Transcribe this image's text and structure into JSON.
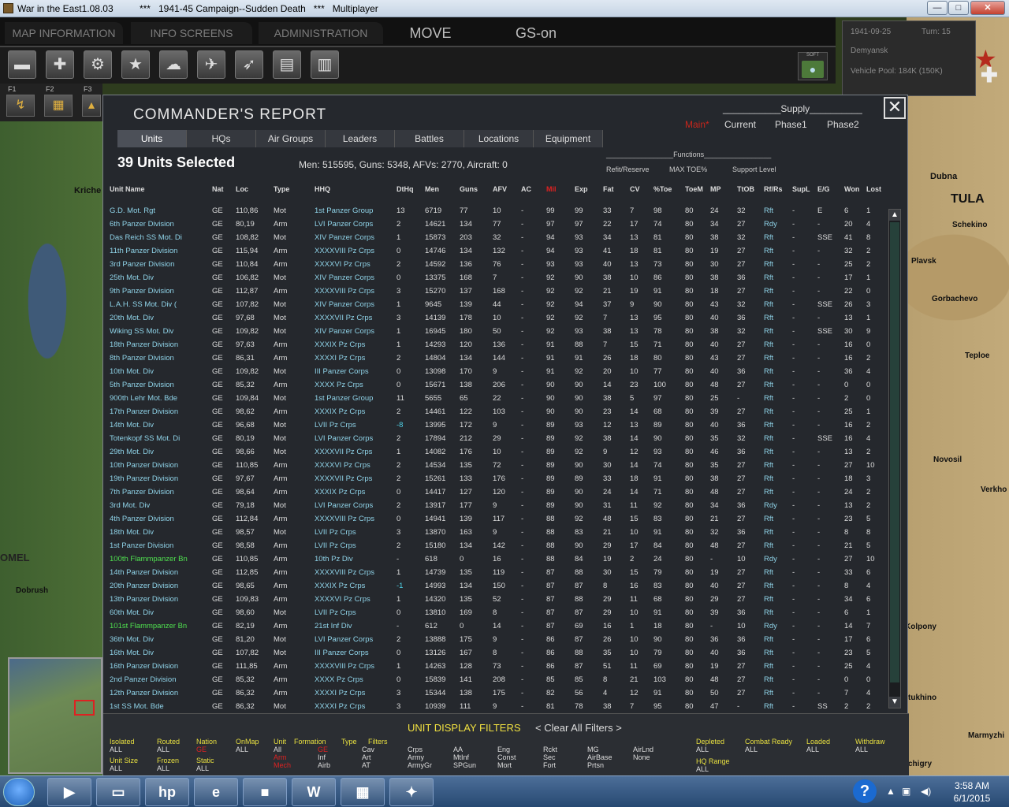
{
  "window": {
    "title": "War in the East1.08.03          ***   1941-45 Campaign--Sudden Death   ***   Multiplayer",
    "min": "—",
    "max": "□",
    "close": "✕"
  },
  "menu": {
    "map_info": "MAP INFORMATION",
    "info_screens": "INFO SCREENS",
    "administration": "ADMINISTRATION",
    "move": "MOVE",
    "gs": "GS-on"
  },
  "info": {
    "date": "1941-09-25",
    "turn": "Turn: 15",
    "location": "Demyansk",
    "vehicle_pool": "Vehicle Pool: 184K (150K)"
  },
  "soft": {
    "label": "SOFT"
  },
  "fkeys": [
    "F1",
    "F2",
    "F3"
  ],
  "report": {
    "title": "COMMANDER'S REPORT",
    "close": "✕",
    "supply": {
      "heading": "___________Supply__________",
      "main": "Main*",
      "current": "Current",
      "phase1": "Phase1",
      "phase2": "Phase2"
    },
    "tabs": [
      "Units",
      "HQs",
      "Air Groups",
      "Leaders",
      "Battles",
      "Locations",
      "Equipment"
    ],
    "selected": "39 Units Selected",
    "stats": "Men: 515595, Guns: 5348, AFVs: 2770, Aircraft: 0",
    "functions": {
      "heading": "_________________Functions_________________",
      "refit": "Refit/Reserve",
      "maxtoe": "MAX TOE%",
      "support": "Support Level"
    },
    "columns": [
      "Unit Name",
      "Nat",
      "Loc",
      "Type",
      "HHQ",
      "DtHq",
      "Men",
      "Guns",
      "AFV",
      "AC",
      "Mil",
      "Exp",
      "Fat",
      "CV",
      "%Toe",
      "ToeM",
      "MP",
      "TtOB",
      "Rf/Rs",
      "SupL",
      "E/G",
      "Won",
      "Lost"
    ],
    "rows": [
      [
        "G.D. Mot. Rgt",
        "GE",
        "110,86",
        "Mot",
        "1st Panzer Group",
        "13",
        "6719",
        "77",
        "10",
        "-",
        "99",
        "99",
        "33",
        "7",
        "98",
        "80",
        "24",
        "32",
        "Rft",
        "-",
        "E",
        "6",
        "1"
      ],
      [
        "6th Panzer Division",
        "GE",
        "80,19",
        "Arm",
        "LVI Panzer Corps",
        "2",
        "14621",
        "134",
        "77",
        "-",
        "97",
        "97",
        "22",
        "17",
        "74",
        "80",
        "34",
        "27",
        "Rdy",
        "-",
        "-",
        "20",
        "4"
      ],
      [
        "Das Reich SS Mot. Di",
        "GE",
        "108,82",
        "Mot",
        "XIV Panzer Corps",
        "1",
        "15873",
        "203",
        "32",
        "-",
        "94",
        "93",
        "34",
        "13",
        "81",
        "80",
        "38",
        "32",
        "Rft",
        "-",
        "SSE",
        "41",
        "8"
      ],
      [
        "11th Panzer Division",
        "GE",
        "115,94",
        "Arm",
        "XXXXVIII Pz Crps",
        "0",
        "14746",
        "134",
        "132",
        "-",
        "94",
        "93",
        "41",
        "18",
        "81",
        "80",
        "19",
        "27",
        "Rft",
        "-",
        "-",
        "32",
        "2"
      ],
      [
        "3rd Panzer Division",
        "GE",
        "110,84",
        "Arm",
        "XXXXVI Pz Crps",
        "2",
        "14592",
        "136",
        "76",
        "-",
        "93",
        "93",
        "40",
        "13",
        "73",
        "80",
        "30",
        "27",
        "Rft",
        "-",
        "-",
        "25",
        "2"
      ],
      [
        "25th Mot. Div",
        "GE",
        "106,82",
        "Mot",
        "XIV Panzer Corps",
        "0",
        "13375",
        "168",
        "7",
        "-",
        "92",
        "90",
        "38",
        "10",
        "86",
        "80",
        "38",
        "36",
        "Rft",
        "-",
        "-",
        "17",
        "1"
      ],
      [
        "9th Panzer Division",
        "GE",
        "112,87",
        "Arm",
        "XXXXVIII Pz Crps",
        "3",
        "15270",
        "137",
        "168",
        "-",
        "92",
        "92",
        "21",
        "19",
        "91",
        "80",
        "18",
        "27",
        "Rft",
        "-",
        "-",
        "22",
        "0"
      ],
      [
        "L.A.H. SS Mot. Div (",
        "GE",
        "107,82",
        "Mot",
        "XIV Panzer Corps",
        "1",
        "9645",
        "139",
        "44",
        "-",
        "92",
        "94",
        "37",
        "9",
        "90",
        "80",
        "43",
        "32",
        "Rft",
        "-",
        "SSE",
        "26",
        "3"
      ],
      [
        "20th Mot. Div",
        "GE",
        "97,68",
        "Mot",
        "XXXXVII Pz Crps",
        "3",
        "14139",
        "178",
        "10",
        "-",
        "92",
        "92",
        "7",
        "13",
        "95",
        "80",
        "40",
        "36",
        "Rft",
        "-",
        "-",
        "13",
        "1"
      ],
      [
        "Wiking SS Mot. Div",
        "GE",
        "109,82",
        "Mot",
        "XIV Panzer Corps",
        "1",
        "16945",
        "180",
        "50",
        "-",
        "92",
        "93",
        "38",
        "13",
        "78",
        "80",
        "38",
        "32",
        "Rft",
        "-",
        "SSE",
        "30",
        "9"
      ],
      [
        "18th Panzer Division",
        "GE",
        "97,63",
        "Arm",
        "XXXIX Pz Crps",
        "1",
        "14293",
        "120",
        "136",
        "-",
        "91",
        "88",
        "7",
        "15",
        "71",
        "80",
        "40",
        "27",
        "Rft",
        "-",
        "-",
        "16",
        "0"
      ],
      [
        "8th Panzer Division",
        "GE",
        "86,31",
        "Arm",
        "XXXXI Pz Crps",
        "2",
        "14804",
        "134",
        "144",
        "-",
        "91",
        "91",
        "26",
        "18",
        "80",
        "80",
        "43",
        "27",
        "Rft",
        "-",
        "-",
        "16",
        "2"
      ],
      [
        "10th Mot. Div",
        "GE",
        "109,82",
        "Mot",
        "III Panzer Corps",
        "0",
        "13098",
        "170",
        "9",
        "-",
        "91",
        "92",
        "20",
        "10",
        "77",
        "80",
        "40",
        "36",
        "Rft",
        "-",
        "-",
        "36",
        "4"
      ],
      [
        "5th Panzer Division",
        "GE",
        "85,32",
        "Arm",
        "XXXX Pz Crps",
        "0",
        "15671",
        "138",
        "206",
        "-",
        "90",
        "90",
        "14",
        "23",
        "100",
        "80",
        "48",
        "27",
        "Rft",
        "-",
        "-",
        "0",
        "0"
      ],
      [
        "900th Lehr Mot. Bde",
        "GE",
        "109,84",
        "Mot",
        "1st Panzer Group",
        "11",
        "5655",
        "65",
        "22",
        "-",
        "90",
        "90",
        "38",
        "5",
        "97",
        "80",
        "25",
        "-",
        "Rft",
        "-",
        "-",
        "2",
        "0"
      ],
      [
        "17th Panzer Division",
        "GE",
        "98,62",
        "Arm",
        "XXXIX Pz Crps",
        "2",
        "14461",
        "122",
        "103",
        "-",
        "90",
        "90",
        "23",
        "14",
        "68",
        "80",
        "39",
        "27",
        "Rft",
        "-",
        "-",
        "25",
        "1"
      ],
      [
        "14th Mot. Div",
        "GE",
        "96,68",
        "Mot",
        "LVII Pz Crps",
        "-8",
        "13995",
        "172",
        "9",
        "-",
        "89",
        "93",
        "12",
        "13",
        "89",
        "80",
        "40",
        "36",
        "Rft",
        "-",
        "-",
        "16",
        "2"
      ],
      [
        "Totenkopf SS Mot. Di",
        "GE",
        "80,19",
        "Mot",
        "LVI Panzer Corps",
        "2",
        "17894",
        "212",
        "29",
        "-",
        "89",
        "92",
        "38",
        "14",
        "90",
        "80",
        "35",
        "32",
        "Rft",
        "-",
        "SSE",
        "16",
        "4"
      ],
      [
        "29th Mot. Div",
        "GE",
        "98,66",
        "Mot",
        "XXXXVII Pz Crps",
        "1",
        "14082",
        "176",
        "10",
        "-",
        "89",
        "92",
        "9",
        "12",
        "93",
        "80",
        "46",
        "36",
        "Rft",
        "-",
        "-",
        "13",
        "2"
      ],
      [
        "10th Panzer Division",
        "GE",
        "110,85",
        "Arm",
        "XXXXVI Pz Crps",
        "2",
        "14534",
        "135",
        "72",
        "-",
        "89",
        "90",
        "30",
        "14",
        "74",
        "80",
        "35",
        "27",
        "Rft",
        "-",
        "-",
        "27",
        "10"
      ],
      [
        "19th Panzer Division",
        "GE",
        "97,67",
        "Arm",
        "XXXXVII Pz Crps",
        "2",
        "15261",
        "133",
        "176",
        "-",
        "89",
        "89",
        "33",
        "18",
        "91",
        "80",
        "38",
        "27",
        "Rft",
        "-",
        "-",
        "18",
        "3"
      ],
      [
        "7th Panzer Division",
        "GE",
        "98,64",
        "Arm",
        "XXXIX Pz Crps",
        "0",
        "14417",
        "127",
        "120",
        "-",
        "89",
        "90",
        "24",
        "14",
        "71",
        "80",
        "48",
        "27",
        "Rft",
        "-",
        "-",
        "24",
        "2"
      ],
      [
        "3rd Mot. Div",
        "GE",
        "79,18",
        "Mot",
        "LVI Panzer Corps",
        "2",
        "13917",
        "177",
        "9",
        "-",
        "89",
        "90",
        "31",
        "11",
        "92",
        "80",
        "34",
        "36",
        "Rdy",
        "-",
        "-",
        "13",
        "2"
      ],
      [
        "4th Panzer Division",
        "GE",
        "112,84",
        "Arm",
        "XXXXVIII Pz Crps",
        "0",
        "14941",
        "139",
        "117",
        "-",
        "88",
        "92",
        "48",
        "15",
        "83",
        "80",
        "21",
        "27",
        "Rft",
        "-",
        "-",
        "23",
        "5"
      ],
      [
        "18th Mot. Div",
        "GE",
        "98,57",
        "Mot",
        "LVII Pz Crps",
        "3",
        "13870",
        "163",
        "9",
        "-",
        "88",
        "83",
        "21",
        "10",
        "91",
        "80",
        "32",
        "36",
        "Rft",
        "-",
        "-",
        "8",
        "8"
      ],
      [
        "1st Panzer Division",
        "GE",
        "98,58",
        "Arm",
        "LVII Pz Crps",
        "2",
        "15180",
        "134",
        "142",
        "-",
        "88",
        "90",
        "29",
        "17",
        "84",
        "80",
        "48",
        "27",
        "Rft",
        "-",
        "-",
        "21",
        "5"
      ],
      [
        "100th Flammpanzer Bn",
        "GE",
        "110,85",
        "Arm",
        "10th Pz Div",
        "-",
        "618",
        "0",
        "16",
        "-",
        "88",
        "84",
        "19",
        "2",
        "24",
        "80",
        "-",
        "10",
        "Rdy",
        "-",
        "-",
        "27",
        "10"
      ],
      [
        "14th Panzer Division",
        "GE",
        "112,85",
        "Arm",
        "XXXXVIII Pz Crps",
        "1",
        "14739",
        "135",
        "119",
        "-",
        "87",
        "88",
        "30",
        "15",
        "79",
        "80",
        "19",
        "27",
        "Rft",
        "-",
        "-",
        "33",
        "6"
      ],
      [
        "20th Panzer Division",
        "GE",
        "98,65",
        "Arm",
        "XXXIX Pz Crps",
        "-1",
        "14993",
        "134",
        "150",
        "-",
        "87",
        "87",
        "8",
        "16",
        "83",
        "80",
        "40",
        "27",
        "Rft",
        "-",
        "-",
        "8",
        "4"
      ],
      [
        "13th Panzer Division",
        "GE",
        "109,83",
        "Arm",
        "XXXXVI Pz Crps",
        "1",
        "14320",
        "135",
        "52",
        "-",
        "87",
        "88",
        "29",
        "11",
        "68",
        "80",
        "29",
        "27",
        "Rft",
        "-",
        "-",
        "34",
        "6"
      ],
      [
        "60th Mot. Div",
        "GE",
        "98,60",
        "Mot",
        "LVII Pz Crps",
        "0",
        "13810",
        "169",
        "8",
        "-",
        "87",
        "87",
        "29",
        "10",
        "91",
        "80",
        "39",
        "36",
        "Rft",
        "-",
        "-",
        "6",
        "1"
      ],
      [
        "101st Flammpanzer Bn",
        "GE",
        "82,19",
        "Arm",
        "21st Inf Div",
        "-",
        "612",
        "0",
        "14",
        "-",
        "87",
        "69",
        "16",
        "1",
        "18",
        "80",
        "-",
        "10",
        "Rdy",
        "-",
        "-",
        "14",
        "7"
      ],
      [
        "36th Mot. Div",
        "GE",
        "81,20",
        "Mot",
        "LVI Panzer Corps",
        "2",
        "13888",
        "175",
        "9",
        "-",
        "86",
        "87",
        "26",
        "10",
        "90",
        "80",
        "36",
        "36",
        "Rft",
        "-",
        "-",
        "17",
        "6"
      ],
      [
        "16th Mot. Div",
        "GE",
        "107,82",
        "Mot",
        "III Panzer Corps",
        "0",
        "13126",
        "167",
        "8",
        "-",
        "86",
        "88",
        "35",
        "10",
        "79",
        "80",
        "40",
        "36",
        "Rft",
        "-",
        "-",
        "23",
        "5"
      ],
      [
        "16th Panzer Division",
        "GE",
        "111,85",
        "Arm",
        "XXXXVIII Pz Crps",
        "1",
        "14263",
        "128",
        "73",
        "-",
        "86",
        "87",
        "51",
        "11",
        "69",
        "80",
        "19",
        "27",
        "Rft",
        "-",
        "-",
        "25",
        "4"
      ],
      [
        "2nd Panzer Division",
        "GE",
        "85,32",
        "Arm",
        "XXXX Pz Crps",
        "0",
        "15839",
        "141",
        "208",
        "-",
        "85",
        "85",
        "8",
        "21",
        "103",
        "80",
        "48",
        "27",
        "Rft",
        "-",
        "-",
        "0",
        "0"
      ],
      [
        "12th Panzer Division",
        "GE",
        "86,32",
        "Arm",
        "XXXXI Pz Crps",
        "3",
        "15344",
        "138",
        "175",
        "-",
        "82",
        "56",
        "4",
        "12",
        "91",
        "80",
        "50",
        "27",
        "Rft",
        "-",
        "-",
        "7",
        "4"
      ],
      [
        "1st SS Mot. Bde",
        "GE",
        "86,32",
        "Mot",
        "XXXXI Pz Crps",
        "3",
        "10939",
        "111",
        "9",
        "-",
        "81",
        "78",
        "38",
        "7",
        "95",
        "80",
        "47",
        "-",
        "Rft",
        "-",
        "SS",
        "2",
        "2"
      ]
    ],
    "filters": {
      "title": "UNIT DISPLAY FILTERS",
      "clear": "< Clear All Filters >",
      "isolated": "Isolated",
      "isolated_v": "ALL",
      "routed": "Routed",
      "routed_v": "ALL",
      "nation": "Nation",
      "nation_v": "GE",
      "onmap": "OnMap",
      "onmap_v": "ALL",
      "unit": "Unit",
      "unit_v": "All",
      "unit_v2": "Arm",
      "unit_v3": "Mech",
      "formation": "Formation",
      "formation_v": "Inf",
      "formation_v2": "Airb",
      "type": "Type",
      "type_v": "Art",
      "type_v2": "AT",
      "filters_lbl": "Filters",
      "filters_v": "Cav",
      "crps": "Crps",
      "army": "Army",
      "armygr": "ArmyGr",
      "aa": "AA",
      "mtinf": "MtInf",
      "spgun": "SPGun",
      "eng": "Eng",
      "const": "Const",
      "mort": "Mort",
      "rckt": "Rckt",
      "sec": "Sec",
      "fort": "Fort",
      "mg": "MG",
      "airbase": "AirBase",
      "prtsn": "Prtsn",
      "airlnd": "AirLnd",
      "none": "None",
      "unitsize": "Unit Size",
      "unitsize_v": "ALL",
      "frozen": "Frozen",
      "frozen_v": "ALL",
      "static": "Static",
      "static_v": "ALL",
      "depleted": "Depleted",
      "depleted_v": "ALL",
      "combatready": "Combat Ready",
      "combatready_v": "ALL",
      "loaded": "Loaded",
      "loaded_v": "ALL",
      "withdraw": "Withdraw",
      "withdraw_v": "ALL",
      "hqrange": "HQ Range",
      "hqrange_v": "ALL"
    }
  },
  "map_labels": {
    "krich": "Kriche",
    "dubna": "Dubna",
    "tula": "TULA",
    "schekino": "Schekino",
    "plavsk": "Plavsk",
    "gorbachevo": "Gorbachevo",
    "teploe": "Teploe",
    "novosil": "Novosil",
    "verkho": "Verkho",
    "kolpony": "Kolpony",
    "tukhino": "tukhino",
    "marmyzhi": "Marmyzhi",
    "chigry": "chigry",
    "gomel": "OMEL",
    "dobrush": "Dobrush"
  },
  "taskbar": {
    "time": "3:58 AM",
    "date": "6/1/2015",
    "help": "?"
  }
}
